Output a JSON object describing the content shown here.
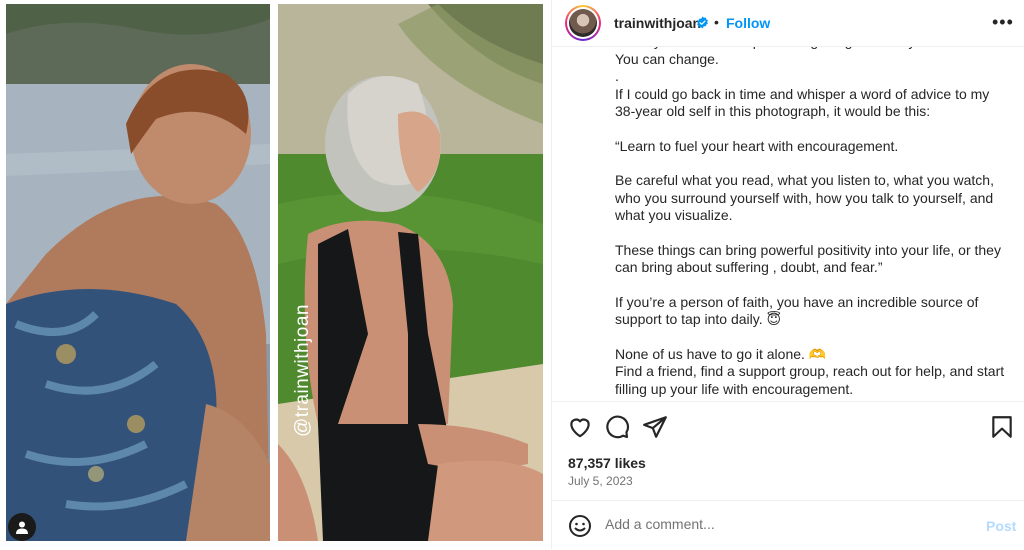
{
  "post": {
    "username": "trainwithjoan",
    "follow_label": "Follow",
    "separator": "•",
    "more_label": "•••",
    "watermark": "@trainwithjoan",
    "likes": "87,357 likes",
    "date": "July 5, 2023"
  },
  "caption": {
    "lines": [
      "mean you have to keep on doing things that way.",
      "You can change.",
      ".",
      "If I could go back in time and whisper a word of advice to my 38-year old self in this photograph, it would be this:",
      "",
      "“Learn to fuel your heart with encouragement.",
      "",
      "Be careful what you read, what you listen to, what you watch, who you surround yourself with, how you talk to yourself, and what you visualize.",
      "",
      "These things can bring powerful positivity into your life, or they can bring about suffering , doubt, and fear.”",
      "",
      "If you’re a person of faith, you have an incredible source of support to tap into daily. 😇",
      "",
      "None of us have to go it alone. 🫶",
      "Find a friend, find a support group, reach out for help, and start filling up your life with encouragement."
    ]
  },
  "comment": {
    "placeholder": "Add a comment...",
    "post_label": "Post"
  },
  "colors": {
    "link": "#0095f6",
    "post_disabled": "#b3dbff",
    "verified": "#0095f6"
  },
  "icons": [
    "verified-badge-icon",
    "more-options-icon",
    "heart-icon",
    "comment-icon",
    "share-icon",
    "bookmark-icon",
    "emoji-icon",
    "user-tag-icon"
  ]
}
